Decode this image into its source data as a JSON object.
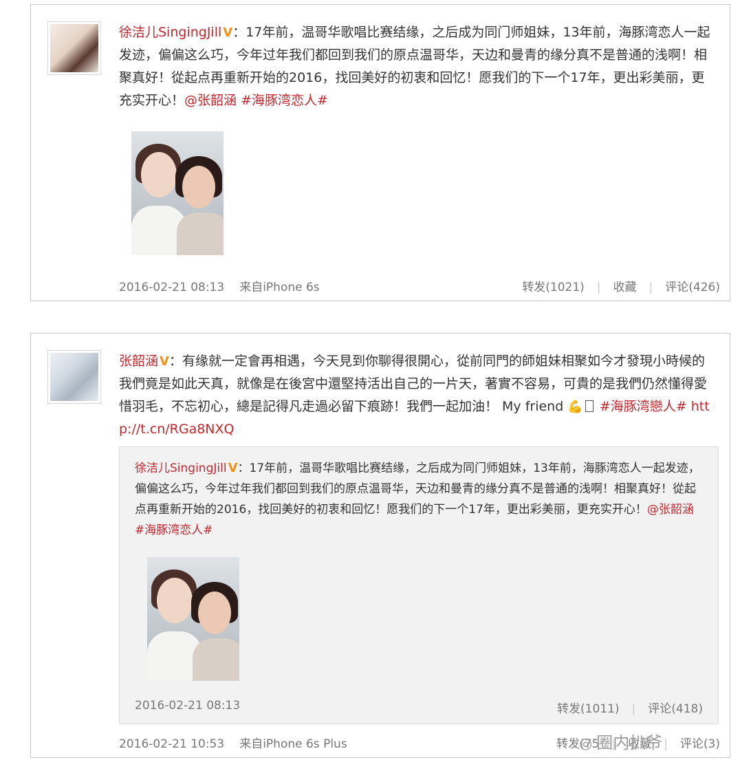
{
  "posts": [
    {
      "author": "徐洁儿SingingJill",
      "verified_badge": "V",
      "text": "：17年前，温哥华歌唱比赛结缘，之后成为同门师姐妹，13年前，海豚湾恋人一起发迹，偏偏这么巧，今年过年我们都回到我们的原点温哥华，天边和曼青的缘分真不是普通的浅啊！相聚真好！從起点再重新开始的2016，找回美好的初衷和回忆！愿我们的下一个17年，更出彩美丽，更充实开心！",
      "mention": "@张韶涵",
      "hashtag": "#海豚湾恋人#",
      "timestamp": "2016-02-21 08:13",
      "source": "来自iPhone 6s",
      "repost_label": "转发(1021)",
      "favorite_label": "收藏",
      "comment_label": "评论(426)"
    },
    {
      "author": "张韶涵",
      "verified_badge": "V",
      "text": "：有缘就一定會再相遇，今天見到你聊得很開心，從前同門的師姐妹相聚如今才發現小時候的我們竟是如此天真，就像是在後宮中還堅持活出自己的一片天，著實不容易，可貴的是我們仍然懂得愛惜羽毛，不忘初心，總是記得凡走過必留下痕跡！我們一起加油！ My friend",
      "emoji": "💪",
      "hashtag": "#海豚湾戀人#",
      "link": "http://t.cn/RGa8NXQ",
      "timestamp": "2016-02-21 10:53",
      "source": "来自iPhone 6s Plus",
      "repost_label": "转发(75",
      "favorite_label": "收藏",
      "comment_label": "评论(3)",
      "quoted": {
        "author": "徐洁儿SingingJill",
        "verified_badge": "V",
        "text": "：17年前，温哥华歌唱比赛结缘，之后成为同门师姐妹，13年前，海豚湾恋人一起发迹，偏偏这么巧，今年过年我们都回到我们的原点温哥华，天边和曼青的缘分真不是普通的浅啊！相聚真好！從起点再重新开始的2016，找回美好的初衷和回忆！愿我们的下一个17年，更出彩美丽，更充实开心！",
        "mention": "@张韶涵",
        "hashtag": "#海豚湾恋人#",
        "timestamp": "2016-02-21 08:13",
        "repost_label": "转发(1011)",
        "comment_label": "评论(418)"
      }
    }
  ],
  "watermark": {
    "text": "圈内扒爷",
    "icon": "wechat-icon"
  },
  "colors": {
    "accent": "#c3262d",
    "badge": "#f29118",
    "meta": "#777777",
    "quote_bg": "#f2f2f2"
  }
}
